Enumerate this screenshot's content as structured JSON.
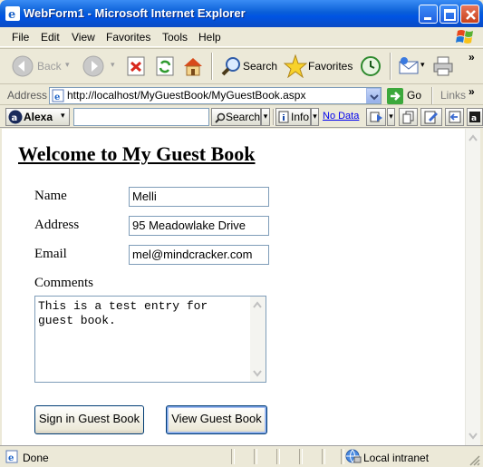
{
  "window": {
    "title": "WebForm1 - Microsoft Internet Explorer"
  },
  "menu": {
    "items": [
      "File",
      "Edit",
      "View",
      "Favorites",
      "Tools",
      "Help"
    ]
  },
  "toolbar": {
    "back_label": "Back",
    "search_label": "Search",
    "favorites_label": "Favorites"
  },
  "address_bar": {
    "label": "Address",
    "url": "http://localhost/MyGuestBook/MyGuestBook.aspx",
    "go_label": "Go",
    "links_label": "Links"
  },
  "alexa_bar": {
    "brand": "Alexa",
    "search_label": "Search",
    "info_label": "Info",
    "nodata_label": "No Data"
  },
  "page": {
    "heading": "Welcome to My Guest Book",
    "fields": {
      "name": {
        "label": "Name",
        "value": "Melli"
      },
      "address": {
        "label": "Address",
        "value": "95 Meadowlake Drive"
      },
      "email": {
        "label": "Email",
        "value": "mel@mindcracker.com"
      },
      "comments": {
        "label": "Comments",
        "value": "This is a test entry for\nguest book."
      }
    },
    "buttons": {
      "sign": "Sign in Guest Book",
      "view": "View Guest Book"
    }
  },
  "status_bar": {
    "status": "Done",
    "zone": "Local intranet"
  },
  "colors": {
    "titlebar": "#0054e3",
    "chrome": "#ece9d8",
    "link": "#0000ee",
    "go_green": "#3ca83c"
  }
}
